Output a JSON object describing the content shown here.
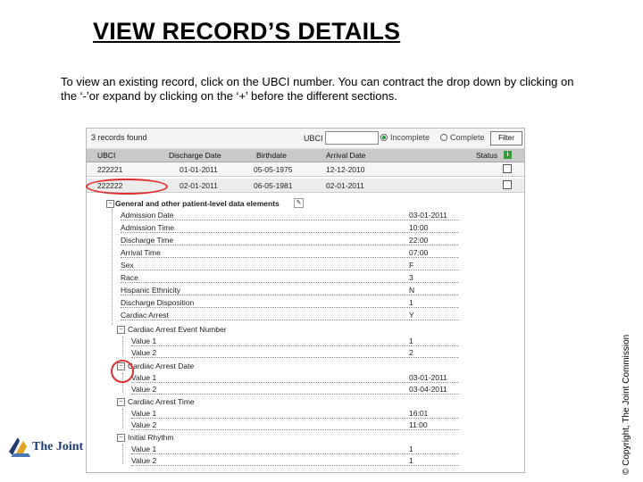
{
  "slide": {
    "title": "VIEW RECORD’S DETAILS",
    "instructions": "To view an existing record, click on the UBCI number. You can contract the drop down by clicking on the ‘-’or expand by clicking on the ‘+’ before the different sections.",
    "copyright": "© Copyright, The Joint Commission",
    "logo_text": "The Joint C"
  },
  "toolbar": {
    "records_found": "3 records found",
    "ubci_label": "UBCI",
    "ubci_value": "",
    "radio_incomplete": "Incomplete",
    "radio_complete": "Complete",
    "filter_label": "Filter"
  },
  "table": {
    "columns": [
      "UBCI",
      "Discharge Date",
      "Birthdate",
      "Arrival Date",
      "Status"
    ],
    "rows": [
      {
        "ubci": "222221",
        "discharge": "01-01-2011",
        "birthdate": "05-05-1975",
        "arrival": "12-12-2010"
      },
      {
        "ubci": "222222",
        "discharge": "02-01-2011",
        "birthdate": "06-05-1981",
        "arrival": "02-01-2011"
      }
    ]
  },
  "tree": {
    "section": "General and other patient-level data elements",
    "items": [
      {
        "label": "Admission Date",
        "value": "03-01-2011"
      },
      {
        "label": "Admission Time",
        "value": "10:00"
      },
      {
        "label": "Discharge Time",
        "value": "22:00"
      },
      {
        "label": "Arrival Time",
        "value": "07:00"
      },
      {
        "label": "Sex",
        "value": "F"
      },
      {
        "label": "Race",
        "value": "3"
      },
      {
        "label": "Hispanic Ethnicity",
        "value": "N"
      },
      {
        "label": "Discharge Disposition",
        "value": "1"
      },
      {
        "label": "Cardiac Arrest",
        "value": "Y"
      }
    ],
    "groups": [
      {
        "label": "Cardiac Arrest Event Number",
        "values": [
          {
            "label": "Value 1",
            "value": "1"
          },
          {
            "label": "Value 2",
            "value": "2"
          }
        ]
      },
      {
        "label": "Cardiac Arrest Date",
        "values": [
          {
            "label": "Value 1",
            "value": "03-01-2011"
          },
          {
            "label": "Value 2",
            "value": "03-04-2011"
          }
        ]
      },
      {
        "label": "Cardiac Arrest Time",
        "values": [
          {
            "label": "Value 1",
            "value": "16:01"
          },
          {
            "label": "Value 2",
            "value": "11:00"
          }
        ]
      },
      {
        "label": "Initial Rhythm",
        "values": [
          {
            "label": "Value 1",
            "value": "1"
          },
          {
            "label": "Value 2",
            "value": "1"
          }
        ]
      }
    ]
  },
  "colors": {
    "highlight": "#e03030",
    "radio_selected": "#1f9a3a",
    "header_bg": "#c9c9c9",
    "logo_blue": "#1f3a6e",
    "logo_gold": "#e3a220"
  }
}
